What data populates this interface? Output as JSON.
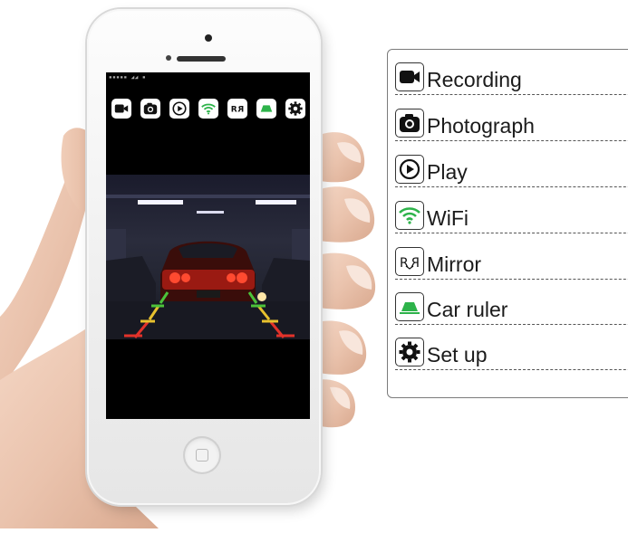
{
  "phone": {
    "status_bar_text": "▪▪▪▪▪ ◢◢ ▪",
    "toolbar": [
      {
        "name": "record-icon",
        "label": "Recording"
      },
      {
        "name": "camera-icon",
        "label": "Photograph"
      },
      {
        "name": "play-icon",
        "label": "Play"
      },
      {
        "name": "wifi-icon",
        "label": "WiFi"
      },
      {
        "name": "mirror-icon",
        "label": "Mirror"
      },
      {
        "name": "car-ruler-icon",
        "label": "Car ruler"
      },
      {
        "name": "gear-icon",
        "label": "Set up"
      }
    ]
  },
  "legend": {
    "items": [
      {
        "icon": "record-icon",
        "label": "Recording"
      },
      {
        "icon": "camera-icon",
        "label": "Photograph"
      },
      {
        "icon": "play-icon",
        "label": "Play"
      },
      {
        "icon": "wifi-icon",
        "label": "WiFi"
      },
      {
        "icon": "mirror-icon",
        "label": "Mirror"
      },
      {
        "icon": "car-ruler-icon",
        "label": "Car ruler"
      },
      {
        "icon": "gear-icon",
        "label": "Set up"
      }
    ]
  },
  "colors": {
    "wifi_green": "#2db34a",
    "ruler_green": "#2db34a",
    "icon_dark": "#111111",
    "guide_red": "#e2322a",
    "guide_yellow": "#e8c12e",
    "guide_green": "#4cc23a"
  }
}
